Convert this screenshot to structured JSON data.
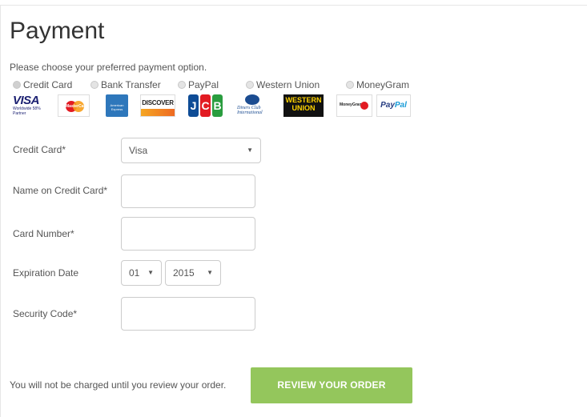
{
  "page": {
    "title": "Payment",
    "subtitle": "Please choose your preferred payment option."
  },
  "payment_options": [
    {
      "label": "Credit Card",
      "selected": true
    },
    {
      "label": "Bank Transfer",
      "selected": false
    },
    {
      "label": "PayPal",
      "selected": false
    },
    {
      "label": "Western Union",
      "selected": false
    },
    {
      "label": "MoneyGram",
      "selected": false
    }
  ],
  "card_logos": [
    {
      "name": "visa-logo",
      "text": "VISA",
      "sub": "Worldwide 58% Partner"
    },
    {
      "name": "mastercard-logo",
      "text": "MasterCard"
    },
    {
      "name": "amex-logo",
      "text": "American Express"
    },
    {
      "name": "discover-logo",
      "text": "DISCOVER"
    },
    {
      "name": "jcb-logo",
      "text": "JCB"
    },
    {
      "name": "diners-club-logo",
      "text": "Diners Club International"
    },
    {
      "name": "western-union-logo",
      "text": "WESTERN UNION"
    },
    {
      "name": "moneygram-logo",
      "text": "MoneyGram"
    },
    {
      "name": "paypal-logo",
      "text": "PayPal"
    }
  ],
  "form": {
    "credit_card": {
      "label": "Credit Card*",
      "value": "Visa"
    },
    "name_on_card": {
      "label": "Name on Credit Card*",
      "value": ""
    },
    "card_number": {
      "label": "Card Number*",
      "value": ""
    },
    "expiration": {
      "label": "Expiration Date",
      "month": "01",
      "year": "2015"
    },
    "security_code": {
      "label": "Security Code*",
      "value": ""
    }
  },
  "footer": {
    "note": "You will not be charged until you review your order.",
    "button": "REVIEW YOUR ORDER"
  },
  "colors": {
    "button_bg": "#94c65c",
    "text": "#555555",
    "title": "#333333",
    "border": "#cccccc"
  }
}
